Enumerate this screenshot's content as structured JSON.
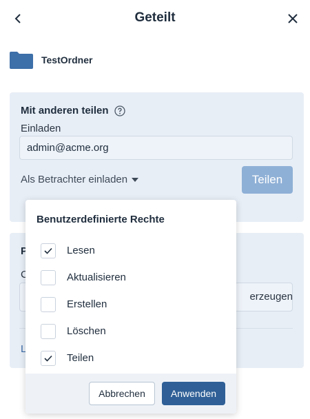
{
  "header": {
    "title": "Geteilt"
  },
  "folder": {
    "name": "TestOrdner"
  },
  "share": {
    "title": "Mit anderen teilen",
    "invite_label": "Einladen",
    "email_value": "admin@acme.org",
    "role_label": "Als Betrachter einladen",
    "share_button": "Teilen"
  },
  "link_panel": {
    "title_partial": "P",
    "field_label_partial": "C",
    "generate_partial": "erzeugen",
    "link_partial": "L"
  },
  "permissions": {
    "title": "Benutzerdefinierte Rechte",
    "items": [
      {
        "label": "Lesen",
        "checked": true
      },
      {
        "label": "Aktualisieren",
        "checked": false
      },
      {
        "label": "Erstellen",
        "checked": false
      },
      {
        "label": "Löschen",
        "checked": false
      },
      {
        "label": "Teilen",
        "checked": true
      }
    ],
    "cancel_button": "Abbrechen",
    "apply_button": "Anwenden"
  },
  "colors": {
    "accent": "#2f5f96",
    "panel_bg": "#e8eef6",
    "share_button_disabled": "#8fb0d6",
    "folder": "#3d6fa8"
  }
}
